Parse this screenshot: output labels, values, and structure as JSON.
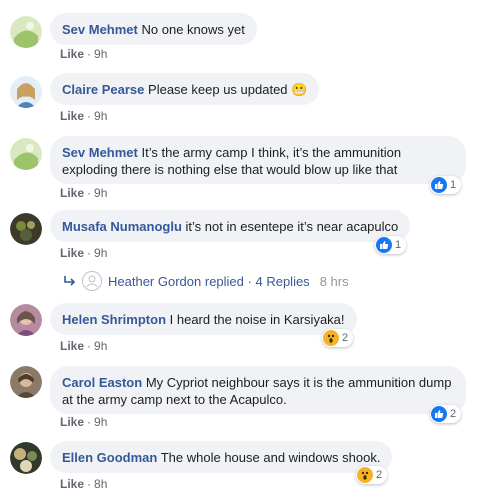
{
  "comments": [
    {
      "author": "Sev Mehmet",
      "text": "No one knows yet",
      "like": "Like",
      "time": "9h"
    },
    {
      "author": "Claire Pearse",
      "text": "Please keep us updated",
      "like": "Like",
      "time": "9h",
      "emoji": "😬"
    },
    {
      "author": "Sev Mehmet",
      "text_line1": "It’s the army camp I think, it’s the ammunition",
      "text_line2": "exploding there is nothing else that would blow up like that",
      "like": "Like",
      "time": "9h",
      "reaction_count": "1"
    },
    {
      "author": "Musafa Numanoglu",
      "text": "it’s not in esentepe it’s near acapulco",
      "like": "Like",
      "time": "9h",
      "reaction_count": "1"
    },
    {
      "author": "Helen Shrimpton",
      "text": "I heard the noise in Karsiyaka!",
      "like": "Like",
      "time": "9h",
      "reaction_count": "2"
    },
    {
      "author": "Carol Easton",
      "text_line1": "My Cypriot neighbour says it is the ammunition dump",
      "text_line2": "at the army camp next to the Acapulco.",
      "like": "Like",
      "time": "9h",
      "reaction_count": "2"
    },
    {
      "author": "Ellen Goodman",
      "text": "The whole house and windows shook.",
      "like": "Like",
      "time": "8h",
      "reaction_count": "2"
    }
  ],
  "reply": {
    "name": "Heather Gordon",
    "replied": "replied",
    "dot": "·",
    "count": "4 Replies",
    "time": "8 hrs"
  },
  "separator": "·",
  "colors": {
    "author": "#365899",
    "bubble": "#f0f2f5",
    "like_reaction": "#1877f2",
    "wow_reaction": "#f7b125"
  }
}
